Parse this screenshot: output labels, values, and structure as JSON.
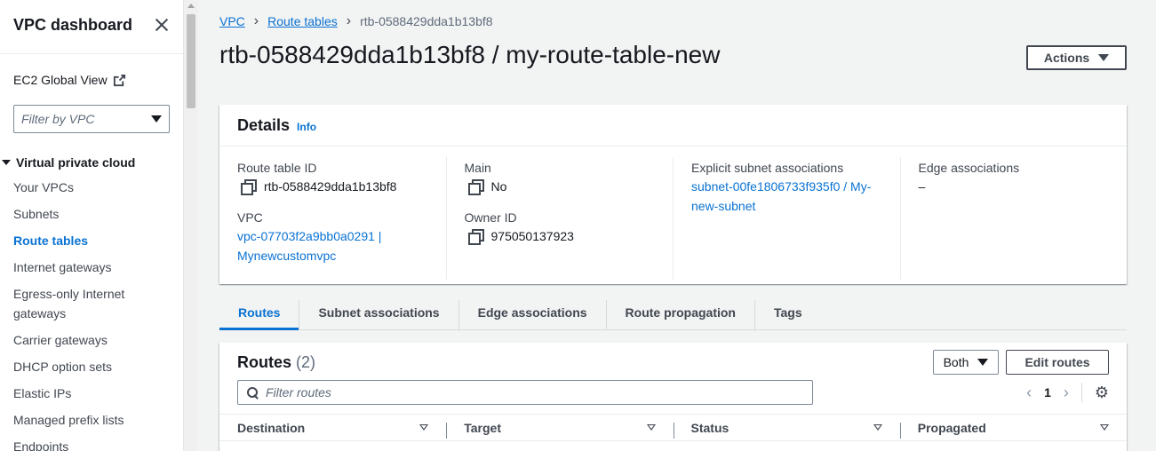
{
  "sidebar": {
    "title": "VPC dashboard",
    "ec2_global_view": "EC2 Global View",
    "filter_placeholder": "Filter by VPC",
    "section": "Virtual private cloud",
    "items": [
      {
        "label": "Your VPCs"
      },
      {
        "label": "Subnets"
      },
      {
        "label": "Route tables",
        "active": true
      },
      {
        "label": "Internet gateways"
      },
      {
        "label": "Egress-only Internet gateways"
      },
      {
        "label": "Carrier gateways"
      },
      {
        "label": "DHCP option sets"
      },
      {
        "label": "Elastic IPs"
      },
      {
        "label": "Managed prefix lists"
      },
      {
        "label": "Endpoints"
      }
    ]
  },
  "breadcrumb": {
    "items": [
      "VPC",
      "Route tables"
    ],
    "current": "rtb-0588429dda1b13bf8"
  },
  "page_title": "rtb-0588429dda1b13bf8 / my-route-table-new",
  "actions_label": "Actions",
  "details": {
    "title": "Details",
    "info": "Info",
    "route_table_id_label": "Route table ID",
    "route_table_id": "rtb-0588429dda1b13bf8",
    "vpc_label": "VPC",
    "vpc_value": "vpc-07703f2a9bb0a0291 | Mynewcustomvpc",
    "main_label": "Main",
    "main_value": "No",
    "owner_label": "Owner ID",
    "owner_value": "975050137923",
    "explicit_label": "Explicit subnet associations",
    "explicit_value": "subnet-00fe1806733f935f0 / My-new-subnet",
    "edge_label": "Edge associations",
    "edge_value": "–"
  },
  "tabs": [
    "Routes",
    "Subnet associations",
    "Edge associations",
    "Route propagation",
    "Tags"
  ],
  "routes": {
    "title": "Routes",
    "count": "(2)",
    "filter_select": "Both",
    "edit_label": "Edit routes",
    "search_placeholder": "Filter routes",
    "page": "1",
    "columns": [
      "Destination",
      "Target",
      "Status",
      "Propagated"
    ]
  },
  "colors": {
    "accent": "#0972d3",
    "text": "#16191f",
    "background": "#f2f3f3"
  }
}
